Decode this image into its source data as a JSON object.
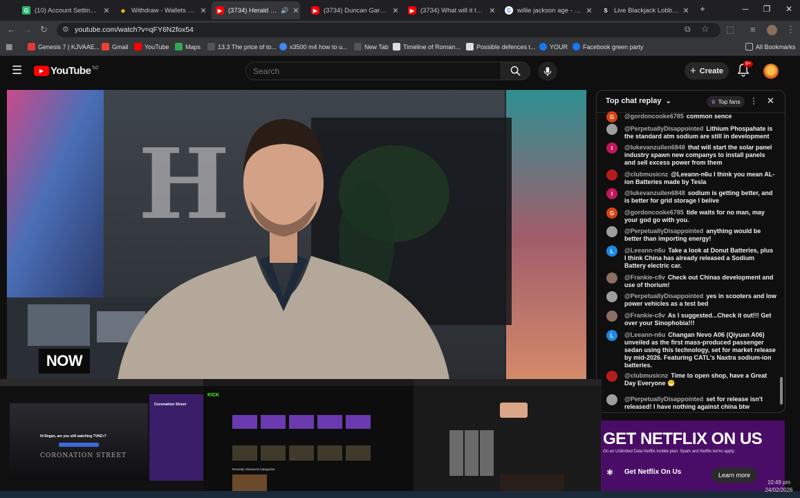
{
  "browser": {
    "tabs": [
      {
        "title": "(10) Account Settings / S",
        "favicon": "green-square-icon",
        "color": "#2bb673"
      },
      {
        "title": "Withdraw - Wallets - Bin",
        "favicon": "binance-icon",
        "color": "#f0b90b"
      },
      {
        "title": "(3734) Herald NOW",
        "favicon": "youtube-icon",
        "color": "#ff0000"
      },
      {
        "title": "(3734) Duncan Garner",
        "favicon": "youtube-icon",
        "color": "#ff0000"
      },
      {
        "title": "(3734) What will it take",
        "favicon": "youtube-icon",
        "color": "#ff0000"
      },
      {
        "title": "willie jackson age - Goo",
        "favicon": "google-icon",
        "color": "#ffffff"
      },
      {
        "title": "Live Blackjack Lobby - Pl",
        "favicon": "stake-icon",
        "color": "#ffffff"
      }
    ],
    "url": "youtube.com/watch?v=qFY6N2fox54",
    "bookmarks": [
      {
        "label": "Genesis 7 | KJVAAE...",
        "color": "#e53935"
      },
      {
        "label": "Gmail",
        "color": "#ea4335"
      },
      {
        "label": "YouTube",
        "color": "#ff0000"
      },
      {
        "label": "Maps",
        "color": "#34a853"
      },
      {
        "label": "13.3 The price of to...",
        "color": "#555555"
      },
      {
        "label": "x3500 m4 how to u...",
        "color": "#4285f4"
      },
      {
        "label": "New Tab",
        "color": "#555555"
      },
      {
        "label": "Timeline of Roman...",
        "color": "#dddddd"
      },
      {
        "label": "Possible defences t...",
        "color": "#dddddd"
      },
      {
        "label": "YOUR",
        "color": "#1877f2"
      },
      {
        "label": "Facebook green party",
        "color": "#1877f2"
      }
    ],
    "all_bookmarks": "All Bookmarks"
  },
  "youtube": {
    "logo_text": "YouTube",
    "region": "NZ",
    "search_placeholder": "Search",
    "create_label": "Create",
    "notifications_badge": "9+"
  },
  "video": {
    "badge": "NOW",
    "logo_letter": "H"
  },
  "chat": {
    "title": "Top chat replay",
    "top_fans_label": "Top fans",
    "messages": [
      {
        "initial": "G",
        "color": "#d84315",
        "author": "@gordoncooke6785",
        "text": "common sence"
      },
      {
        "initial": "",
        "color": "#9e9e9e",
        "author": "@PerpetuallyDisappointed",
        "text": "Lithium Phospahate is the standard atm sodium are still in development"
      },
      {
        "initial": "l",
        "color": "#c2185b",
        "author": "@lukevanzuilen6848",
        "text": "that will start the solar panel industry spawn new companys to install panels and sell excess power from them"
      },
      {
        "initial": "",
        "color": "#b71c1c",
        "author": "@clubmusicnz",
        "text": "@Leeann-n6u I think you mean AL-ion Batteries made by Tesla"
      },
      {
        "initial": "l",
        "color": "#c2185b",
        "author": "@lukevanzuilen6848",
        "text": "sodium is getting better, and is better for grid storage I belive"
      },
      {
        "initial": "G",
        "color": "#d84315",
        "author": "@gordoncooke6785",
        "text": "tide waits for no man, may your god go with you."
      },
      {
        "initial": "",
        "color": "#9e9e9e",
        "author": "@PerpetuallyDisappointed",
        "text": "anything would be better than importing energy!"
      },
      {
        "initial": "L",
        "color": "#1e88e5",
        "author": "@Leeann-n6u",
        "text": "Take a look at Donut Batteries, plus I think China has already released a Sodium Battery electric car."
      },
      {
        "initial": "",
        "color": "#8d6e63",
        "author": "@Frankie-c8v",
        "text": "Check out Chinas development and use of thorium!"
      },
      {
        "initial": "",
        "color": "#9e9e9e",
        "author": "@PerpetuallyDisappointed",
        "text": "yes in scooters and low power vehicles as a test bed"
      },
      {
        "initial": "",
        "color": "#8d6e63",
        "author": "@Frankie-c8v",
        "text": "As I suggested...Check it out!!! Get over your Sinophobia!!!"
      },
      {
        "initial": "L",
        "color": "#1e88e5",
        "author": "@Leeann-n6u",
        "text": "Changan Nevo A06 (Qiyuan A06) unveiled as the first mass-produced passenger sedan using this technology, set for market release by mid-2026. Featuring CATL's Naxtra sodium-ion batteries."
      },
      {
        "initial": "",
        "color": "#b71c1c",
        "author": "@clubmusicnz",
        "text": "Time to open shop, have a Great Day Everyone 😁"
      },
      {
        "initial": "",
        "color": "#9e9e9e",
        "author": "@PerpetuallyDisappointed",
        "text": "set for release isn't released! I have nothing against china btw"
      }
    ]
  },
  "thumbnails": {
    "first_title": "Coronation Street",
    "first_prompt": "Hi Regan, are you still watching TVNZ+?",
    "first_watermark": "CORONATION STREET",
    "second_heading": "Recently Streamed Categories"
  },
  "ad": {
    "headline": "GET NETFLIX ON US",
    "subline": "On an Unlimited Data Netflix mobile plan. Spark and Netflix terms apply.",
    "cta_title": "Get Netflix On Us",
    "cta_button": "Learn more"
  },
  "system": {
    "time": "10:49 pm",
    "date": "24/02/2026"
  }
}
